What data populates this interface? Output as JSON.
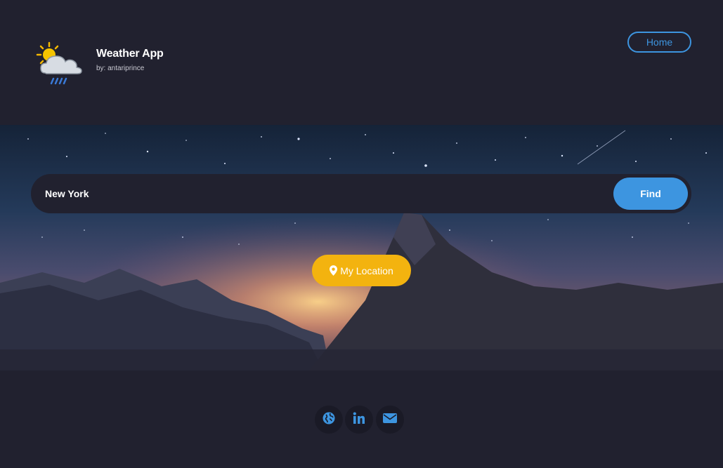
{
  "header": {
    "title": "Weather App",
    "subtitle": "by: antariprince",
    "logo_icon": "sun-cloud-rain-icon",
    "nav": {
      "home_label": "Home"
    }
  },
  "search": {
    "value": "New York",
    "find_label": "Find"
  },
  "location": {
    "label": "My Location",
    "icon": "map-marker-icon"
  },
  "footer": {
    "links": [
      {
        "icon": "globe-icon"
      },
      {
        "icon": "linkedin-icon"
      },
      {
        "icon": "envelope-icon"
      }
    ]
  },
  "colors": {
    "background": "#21212f",
    "accent_blue": "#3d95e0",
    "accent_yellow": "#f3b30f"
  }
}
